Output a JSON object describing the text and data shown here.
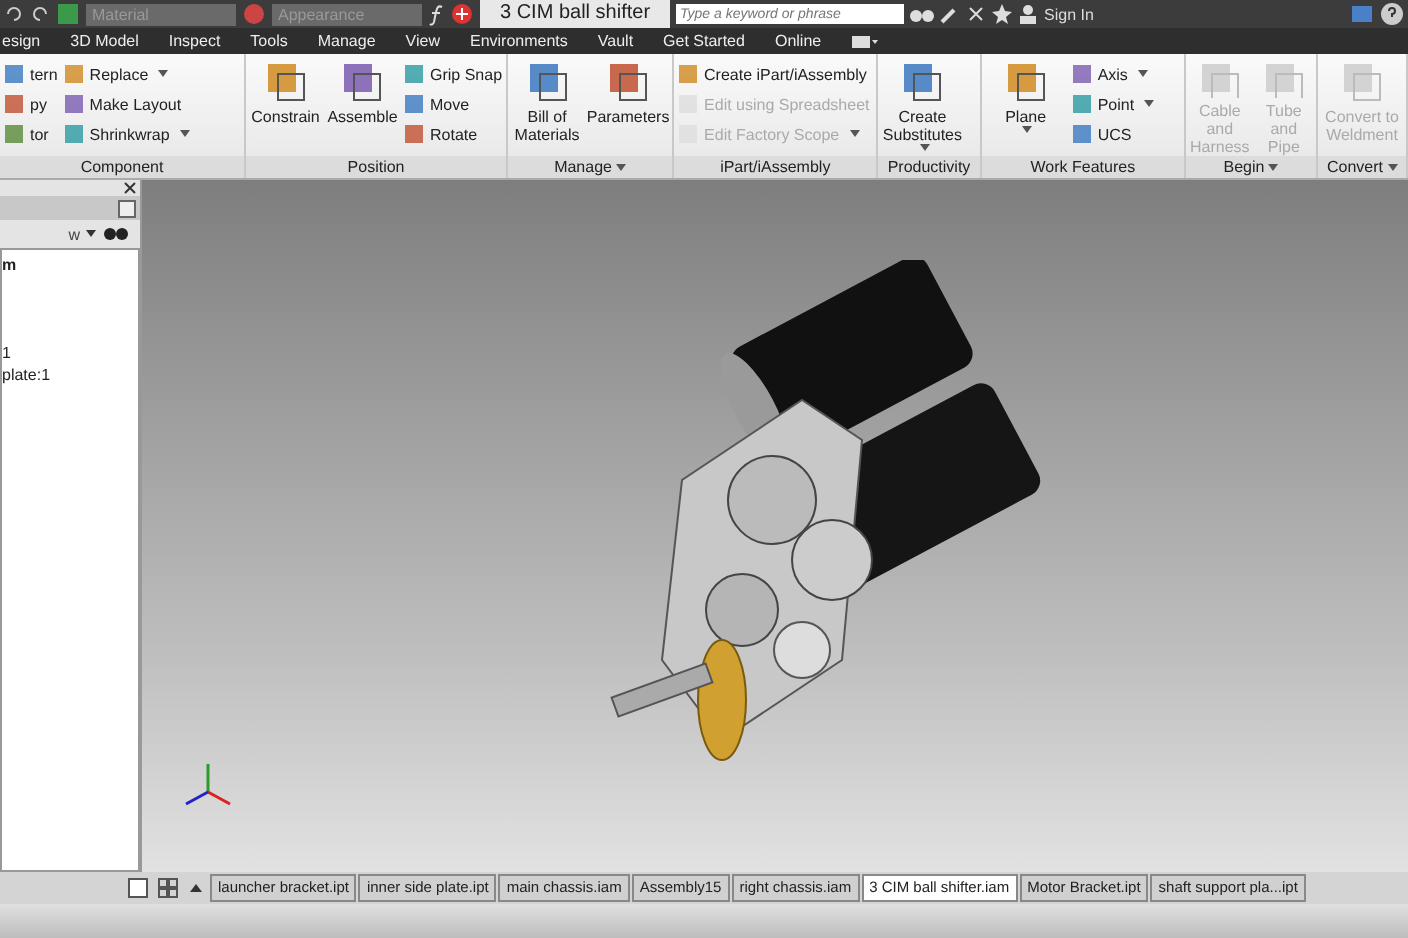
{
  "quick_access": {
    "material_placeholder": "Material",
    "appearance_placeholder": "Appearance"
  },
  "document_title": "3 CIM ball shifter",
  "search": {
    "placeholder": "Type a keyword or phrase"
  },
  "sign_in": "Sign In",
  "menu_tabs": [
    {
      "label": "esign",
      "selected": false
    },
    {
      "label": "3D Model",
      "selected": false
    },
    {
      "label": "Inspect",
      "selected": false
    },
    {
      "label": "Tools",
      "selected": false
    },
    {
      "label": "Manage",
      "selected": false
    },
    {
      "label": "View",
      "selected": false
    },
    {
      "label": "Environments",
      "selected": false
    },
    {
      "label": "Vault",
      "selected": false
    },
    {
      "label": "Get Started",
      "selected": false
    },
    {
      "label": "Online",
      "selected": false
    }
  ],
  "ribbon_panels": [
    {
      "title": "Component",
      "dropdown": false,
      "tools": [
        {
          "label": "tern",
          "kind": "small",
          "disabled": false,
          "dropdown": false
        },
        {
          "label": "py",
          "kind": "small",
          "disabled": false,
          "dropdown": false
        },
        {
          "label": "tor",
          "kind": "small",
          "disabled": false,
          "dropdown": false
        },
        {
          "label": "Replace",
          "kind": "small",
          "disabled": false,
          "dropdown": true
        },
        {
          "label": "Make Layout",
          "kind": "small",
          "disabled": false,
          "dropdown": false
        },
        {
          "label": "Shrinkwrap",
          "kind": "small",
          "disabled": false,
          "dropdown": true
        }
      ]
    },
    {
      "title": "Position",
      "dropdown": false,
      "tools": [
        {
          "label": "Constrain",
          "kind": "large",
          "disabled": false,
          "dropdown": false
        },
        {
          "label": "Assemble",
          "kind": "large",
          "disabled": false,
          "dropdown": false
        },
        {
          "label": "Grip Snap",
          "kind": "small",
          "disabled": false,
          "dropdown": false
        },
        {
          "label": "Move",
          "kind": "small",
          "disabled": false,
          "dropdown": false
        },
        {
          "label": "Rotate",
          "kind": "small",
          "disabled": false,
          "dropdown": false
        }
      ]
    },
    {
      "title": "Manage",
      "dropdown": true,
      "tools": [
        {
          "label": "Bill of Materials",
          "kind": "large",
          "disabled": false,
          "dropdown": false
        },
        {
          "label": "Parameters",
          "kind": "large",
          "disabled": false,
          "dropdown": false
        }
      ]
    },
    {
      "title": "iPart/iAssembly",
      "dropdown": false,
      "tools": [
        {
          "label": "Create iPart/iAssembly",
          "kind": "small",
          "disabled": false,
          "dropdown": false
        },
        {
          "label": "Edit using Spreadsheet",
          "kind": "small",
          "disabled": true,
          "dropdown": false
        },
        {
          "label": "Edit Factory Scope",
          "kind": "small",
          "disabled": true,
          "dropdown": true
        }
      ]
    },
    {
      "title": "Productivity",
      "dropdown": false,
      "tools": [
        {
          "label": "Create Substitutes",
          "kind": "large",
          "disabled": false,
          "dropdown": true
        }
      ]
    },
    {
      "title": "Work Features",
      "dropdown": false,
      "tools": [
        {
          "label": "Plane",
          "kind": "large",
          "disabled": false,
          "dropdown": true
        },
        {
          "label": "Axis",
          "kind": "small",
          "disabled": false,
          "dropdown": true
        },
        {
          "label": "Point",
          "kind": "small",
          "disabled": false,
          "dropdown": true
        },
        {
          "label": "UCS",
          "kind": "small",
          "disabled": false,
          "dropdown": false
        }
      ]
    },
    {
      "title": "Begin",
      "dropdown": true,
      "tools": [
        {
          "label": "Cable and Harness",
          "kind": "large",
          "disabled": true,
          "dropdown": false
        },
        {
          "label": "Tube and Pipe",
          "kind": "large",
          "disabled": true,
          "dropdown": false
        }
      ]
    },
    {
      "title": "Convert",
      "dropdown": true,
      "tools": [
        {
          "label": "Convert to Weldment",
          "kind": "large",
          "disabled": true,
          "dropdown": false
        }
      ]
    }
  ],
  "browser": {
    "header": "w",
    "items": [
      {
        "label": "m",
        "bold": true
      },
      {
        "label": "1",
        "bold": false
      },
      {
        "label": "plate:1",
        "bold": false
      }
    ]
  },
  "document_tabs": [
    {
      "label": "launcher bracket.ipt",
      "selected": false
    },
    {
      "label": "inner side plate.ipt",
      "selected": false
    },
    {
      "label": "main chassis.iam",
      "selected": false
    },
    {
      "label": "Assembly15",
      "selected": false
    },
    {
      "label": "right chassis.iam",
      "selected": false
    },
    {
      "label": "3 CIM ball shifter.iam",
      "selected": true
    },
    {
      "label": "Motor Bracket.ipt",
      "selected": false
    },
    {
      "label": "shaft support pla...ipt",
      "selected": false
    }
  ]
}
